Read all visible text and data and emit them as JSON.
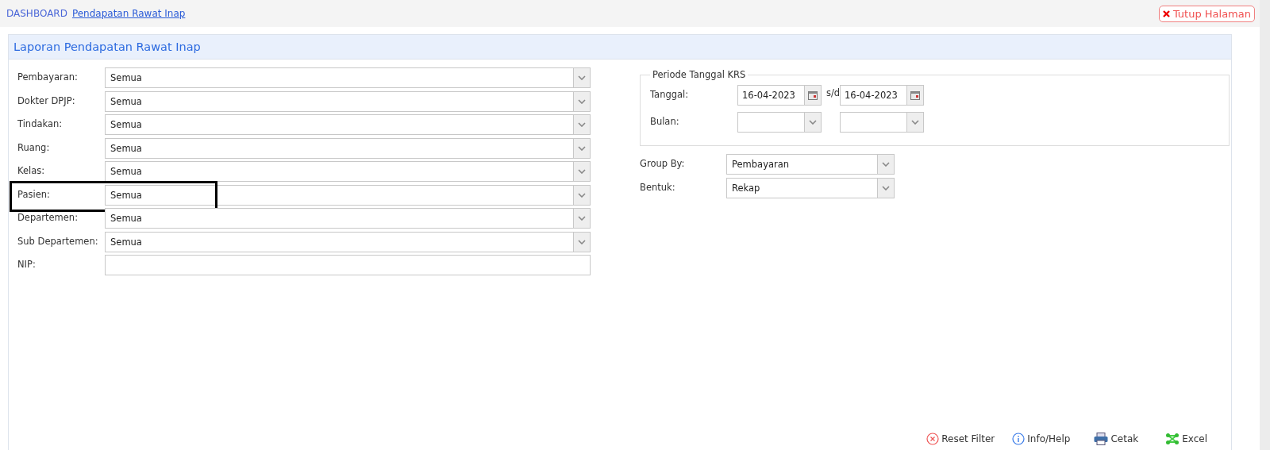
{
  "breadcrumb": [
    {
      "label": "DASHBOARD",
      "kind": "plain"
    },
    {
      "label": "Pendapatan Rawat Inap",
      "kind": "link"
    }
  ],
  "close_button": {
    "label": "Tutup Halaman"
  },
  "panel": {
    "title": "Laporan Pendapatan Rawat Inap"
  },
  "filters": [
    {
      "label": "Pembayaran:",
      "kind": "select",
      "value": "Semua",
      "highlighted": false
    },
    {
      "label": "Dokter DPJP:",
      "kind": "select",
      "value": "Semua",
      "highlighted": false
    },
    {
      "label": "Tindakan:",
      "kind": "select",
      "value": "Semua",
      "highlighted": false
    },
    {
      "label": "Ruang:",
      "kind": "select",
      "value": "Semua",
      "highlighted": false
    },
    {
      "label": "Kelas:",
      "kind": "select",
      "value": "Semua",
      "highlighted": false
    },
    {
      "label": "Pasien:",
      "kind": "select",
      "value": "Semua",
      "highlighted": true
    },
    {
      "label": "Departemen:",
      "kind": "select",
      "value": "Semua",
      "highlighted": false
    },
    {
      "label": "Sub Departemen:",
      "kind": "select",
      "value": "Semua",
      "highlighted": false
    },
    {
      "label": "NIP:",
      "kind": "text",
      "highlighted": false
    }
  ],
  "period": {
    "legend": "Periode Tanggal KRS",
    "date_label": "Tanggal:",
    "date_from": "16-04-2023",
    "separator": "s/d",
    "date_to": "16-04-2023",
    "month_label": "Bulan:"
  },
  "options": [
    {
      "label": "Group By:",
      "value": "Pembayaran"
    },
    {
      "label": "Bentuk:",
      "value": "Rekap"
    }
  ],
  "actions": [
    {
      "label": "Reset Filter",
      "kind": "reset"
    },
    {
      "label": "Info/Help",
      "kind": "info"
    },
    {
      "label": "Cetak",
      "kind": "print"
    },
    {
      "label": "Excel",
      "kind": "excel"
    }
  ]
}
